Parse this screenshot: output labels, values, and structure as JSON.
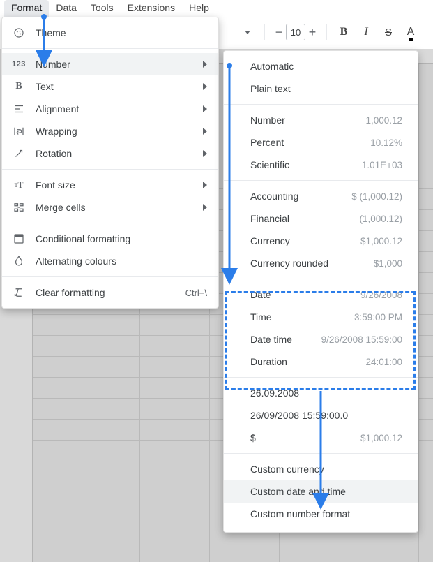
{
  "menubar": {
    "items": [
      "Format",
      "Data",
      "Tools",
      "Extensions",
      "Help"
    ],
    "active": "Format"
  },
  "toolbar": {
    "font_size_value": "10"
  },
  "format_menu": {
    "items": [
      {
        "id": "theme",
        "label": "Theme",
        "icon": "palette",
        "submenu": false
      },
      {
        "sep": true
      },
      {
        "id": "number",
        "label": "Number",
        "icon": "123",
        "submenu": true,
        "hover": true
      },
      {
        "id": "text",
        "label": "Text",
        "icon": "bold-B",
        "submenu": true
      },
      {
        "id": "alignment",
        "label": "Alignment",
        "icon": "align",
        "submenu": true
      },
      {
        "id": "wrapping",
        "label": "Wrapping",
        "icon": "wrap",
        "submenu": true
      },
      {
        "id": "rotation",
        "label": "Rotation",
        "icon": "rotate",
        "submenu": true
      },
      {
        "sep": true
      },
      {
        "id": "fontsize",
        "label": "Font size",
        "icon": "fontsize",
        "submenu": true
      },
      {
        "id": "merge",
        "label": "Merge cells",
        "icon": "merge",
        "submenu": true
      },
      {
        "sep": true
      },
      {
        "id": "cond",
        "label": "Conditional formatting",
        "icon": "cond",
        "submenu": false
      },
      {
        "id": "alt",
        "label": "Alternating colours",
        "icon": "drop",
        "submenu": false
      },
      {
        "sep": true
      },
      {
        "id": "clear",
        "label": "Clear formatting",
        "icon": "clear",
        "submenu": false,
        "shortcut": "Ctrl+\\"
      }
    ]
  },
  "number_menu": {
    "groups": [
      [
        {
          "id": "auto",
          "label": "Automatic",
          "sample": ""
        },
        {
          "id": "plain",
          "label": "Plain text",
          "sample": ""
        }
      ],
      [
        {
          "id": "num",
          "label": "Number",
          "sample": "1,000.12"
        },
        {
          "id": "pct",
          "label": "Percent",
          "sample": "10.12%"
        },
        {
          "id": "sci",
          "label": "Scientific",
          "sample": "1.01E+03"
        }
      ],
      [
        {
          "id": "acct",
          "label": "Accounting",
          "sample": "$ (1,000.12)"
        },
        {
          "id": "fin",
          "label": "Financial",
          "sample": "(1,000.12)"
        },
        {
          "id": "curr",
          "label": "Currency",
          "sample": "$1,000.12"
        },
        {
          "id": "currr",
          "label": "Currency rounded",
          "sample": "$1,000"
        }
      ],
      [
        {
          "id": "date",
          "label": "Date",
          "sample": "9/26/2008"
        },
        {
          "id": "time",
          "label": "Time",
          "sample": "3:59:00 PM"
        },
        {
          "id": "datetime",
          "label": "Date time",
          "sample": "9/26/2008 15:59:00"
        },
        {
          "id": "dur",
          "label": "Duration",
          "sample": "24:01:00"
        }
      ],
      [
        {
          "id": "cfmt1",
          "label": "26.09.2008",
          "sample": ""
        },
        {
          "id": "cfmt2",
          "label": "26/09/2008 15:59:00.0",
          "sample": ""
        },
        {
          "id": "cfmt3",
          "label": "$",
          "sample": "$1,000.12"
        }
      ],
      [
        {
          "id": "ccurr",
          "label": "Custom currency",
          "sample": ""
        },
        {
          "id": "cdt",
          "label": "Custom date and time",
          "sample": "",
          "hover": true
        },
        {
          "id": "cnum",
          "label": "Custom number format",
          "sample": ""
        }
      ]
    ]
  }
}
